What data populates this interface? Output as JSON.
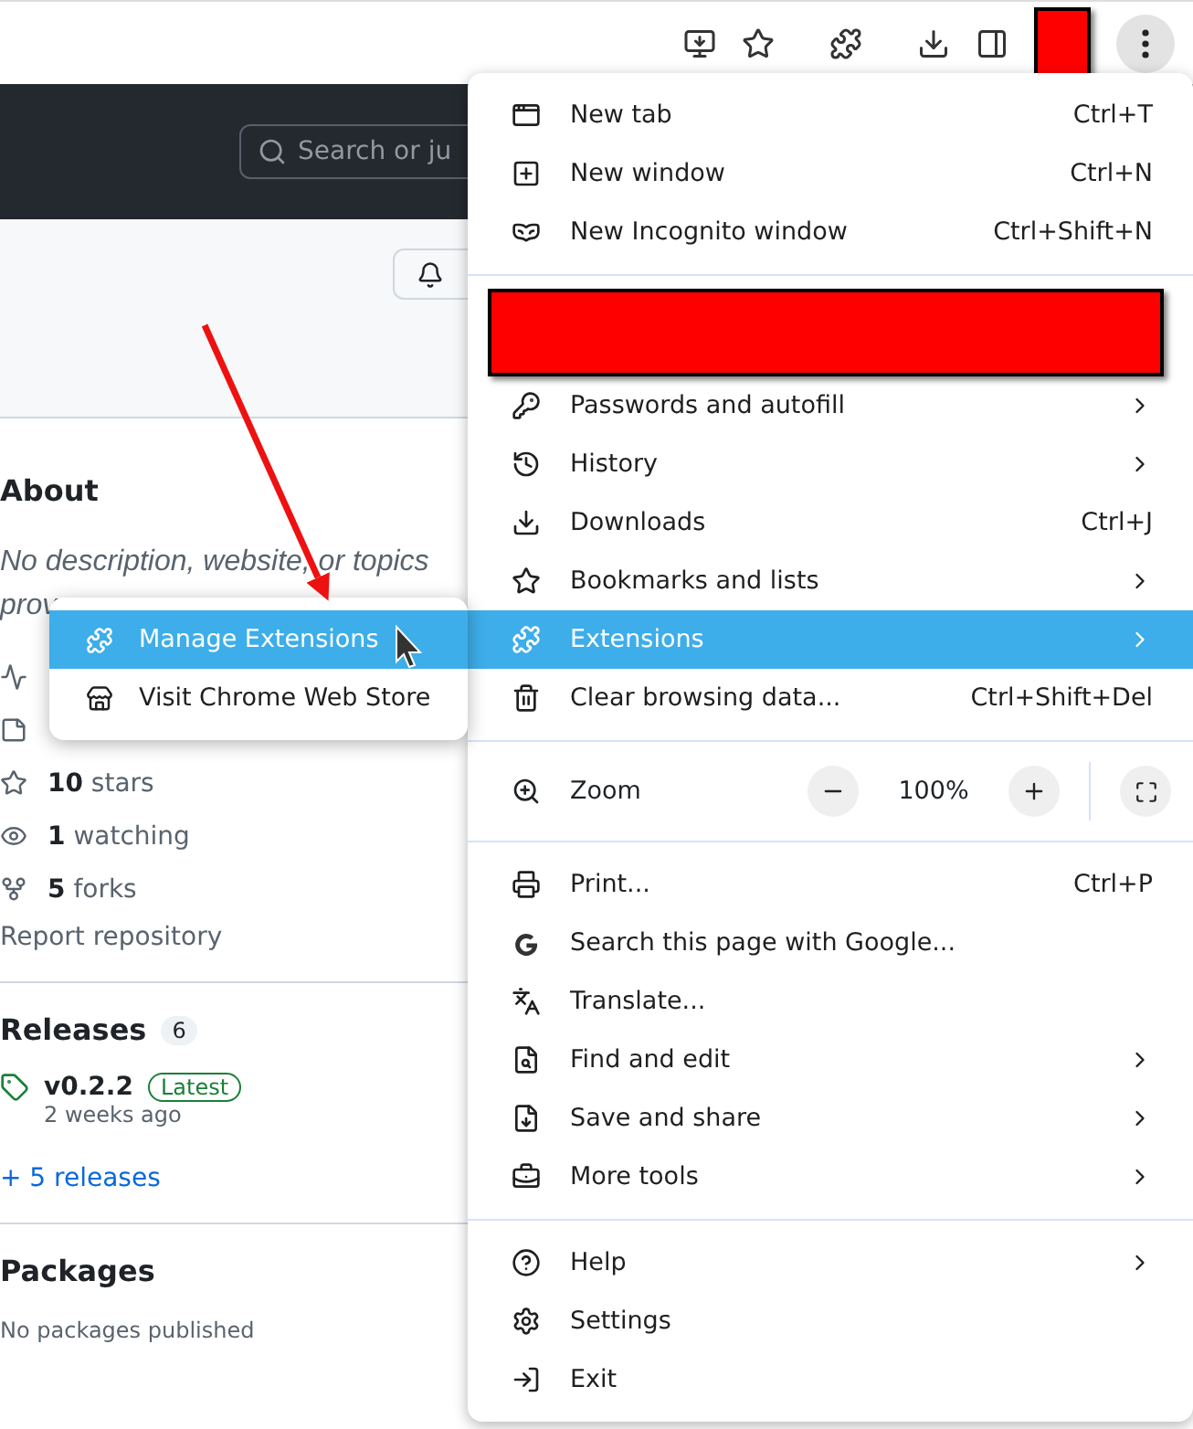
{
  "page": {
    "search_placeholder": "Search or ju",
    "about": {
      "title": "About",
      "description": "No description, website, or topics prov",
      "stats": [
        {
          "text": "**10** stars"
        },
        {
          "text": "**1** watching"
        },
        {
          "text": "**5** forks"
        }
      ],
      "report": "Report repository"
    },
    "releases": {
      "title": "Releases",
      "count": "6",
      "version": "v0.2.2",
      "badge": "Latest",
      "date": "2 weeks ago",
      "more": "+ 5 releases"
    },
    "packages": {
      "title": "Packages",
      "text": "No packages published"
    }
  },
  "menu": {
    "sections": [
      {
        "items": [
          {
            "kind": "item",
            "label": "New tab",
            "shortcut": "Ctrl+T",
            "submenu": false,
            "selected": false
          },
          {
            "kind": "item",
            "label": "New window",
            "shortcut": "Ctrl+N",
            "submenu": false,
            "selected": false
          },
          {
            "kind": "item",
            "label": "New Incognito window",
            "shortcut": "Ctrl+Shift+N",
            "submenu": false,
            "selected": false
          }
        ]
      },
      {
        "items": [
          {
            "kind": "redacted"
          },
          {
            "kind": "item",
            "label": "Passwords and autofill",
            "submenu": true,
            "selected": false
          },
          {
            "kind": "item",
            "label": "History",
            "submenu": true,
            "selected": false
          },
          {
            "kind": "item",
            "label": "Downloads",
            "shortcut": "Ctrl+J",
            "submenu": false,
            "selected": false
          },
          {
            "kind": "item",
            "label": "Bookmarks and lists",
            "submenu": true,
            "selected": false
          },
          {
            "kind": "item",
            "label": "Extensions",
            "submenu": true,
            "selected": true
          },
          {
            "kind": "item",
            "label": "Clear browsing data...",
            "shortcut": "Ctrl+Shift+Del",
            "submenu": false,
            "selected": false
          }
        ]
      },
      {
        "items": [
          {
            "kind": "zoom",
            "label": "Zoom",
            "value": "100%"
          }
        ]
      },
      {
        "items": [
          {
            "kind": "item",
            "label": "Print...",
            "shortcut": "Ctrl+P",
            "submenu": false,
            "selected": false
          },
          {
            "kind": "item",
            "label": "Search this page with Google...",
            "submenu": false,
            "selected": false
          },
          {
            "kind": "item",
            "label": "Translate...",
            "submenu": false,
            "selected": false
          },
          {
            "kind": "item",
            "label": "Find and edit",
            "submenu": true,
            "selected": false
          },
          {
            "kind": "item",
            "label": "Save and share",
            "submenu": true,
            "selected": false
          },
          {
            "kind": "item",
            "label": "More tools",
            "submenu": true,
            "selected": false
          }
        ]
      },
      {
        "items": [
          {
            "kind": "item",
            "label": "Help",
            "submenu": true,
            "selected": false
          },
          {
            "kind": "item",
            "label": "Settings",
            "submenu": false,
            "selected": false
          },
          {
            "kind": "item",
            "label": "Exit",
            "submenu": false,
            "selected": false
          }
        ]
      }
    ]
  },
  "submenu": {
    "items": [
      {
        "label": "Manage Extensions",
        "selected": true
      },
      {
        "label": "Visit Chrome Web Store",
        "selected": false
      }
    ]
  }
}
